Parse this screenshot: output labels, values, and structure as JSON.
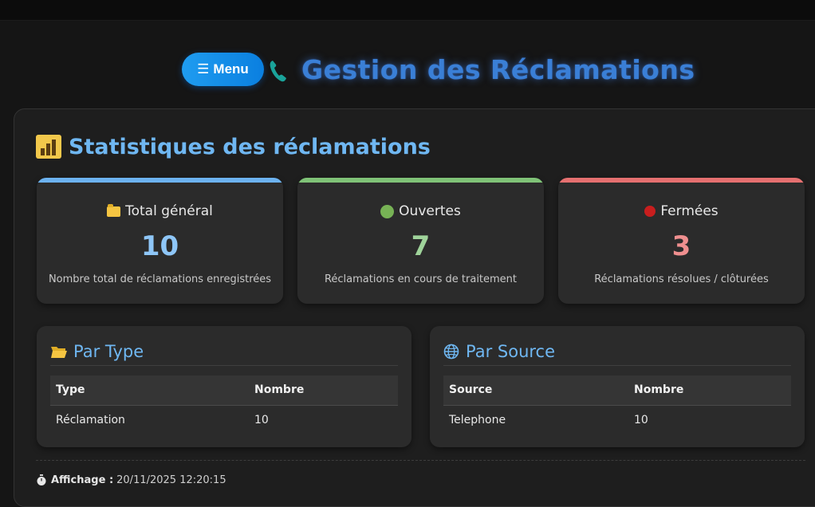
{
  "header": {
    "menu_icon": "☰",
    "menu_label": "Menu",
    "phone_icon": "phone-icon",
    "title": "Gestion des Réclamations"
  },
  "stats": {
    "title": "Statistiques des réclamations",
    "icon": "bar-chart-icon",
    "cards": [
      {
        "label": "Total général",
        "value": "10",
        "description": "Nombre total de réclamations enregistrées",
        "icon": "folder-icon",
        "accent": "#6cb2f0",
        "value_color": "#8ec6f7"
      },
      {
        "label": "Ouvertes",
        "value": "7",
        "description": "Réclamations en cours de traitement",
        "icon": "green-circle-icon",
        "accent": "#7fc277",
        "value_color": "#9fd39a"
      },
      {
        "label": "Fermées",
        "value": "3",
        "description": "Réclamations résolues / clôturées",
        "icon": "red-circle-icon",
        "accent": "#e57070",
        "value_color": "#ef8f8f"
      }
    ]
  },
  "par_type": {
    "title": "Par Type",
    "icon": "open-folder-icon",
    "headers": [
      "Type",
      "Nombre"
    ],
    "rows": [
      [
        "Réclamation",
        "10"
      ]
    ]
  },
  "par_source": {
    "title": "Par Source",
    "icon": "globe-icon",
    "headers": [
      "Source",
      "Nombre"
    ],
    "rows": [
      [
        "Telephone",
        "10"
      ]
    ]
  },
  "footer": {
    "icon": "stopwatch-icon",
    "label": "Affichage :",
    "value": "20/11/2025 12:20:15"
  },
  "colors": {
    "background": "#151515",
    "panel": "#1e1e1e",
    "card": "#2b2b2b",
    "title_blue": "#3a7fd6",
    "section_blue": "#6fb7f2"
  }
}
